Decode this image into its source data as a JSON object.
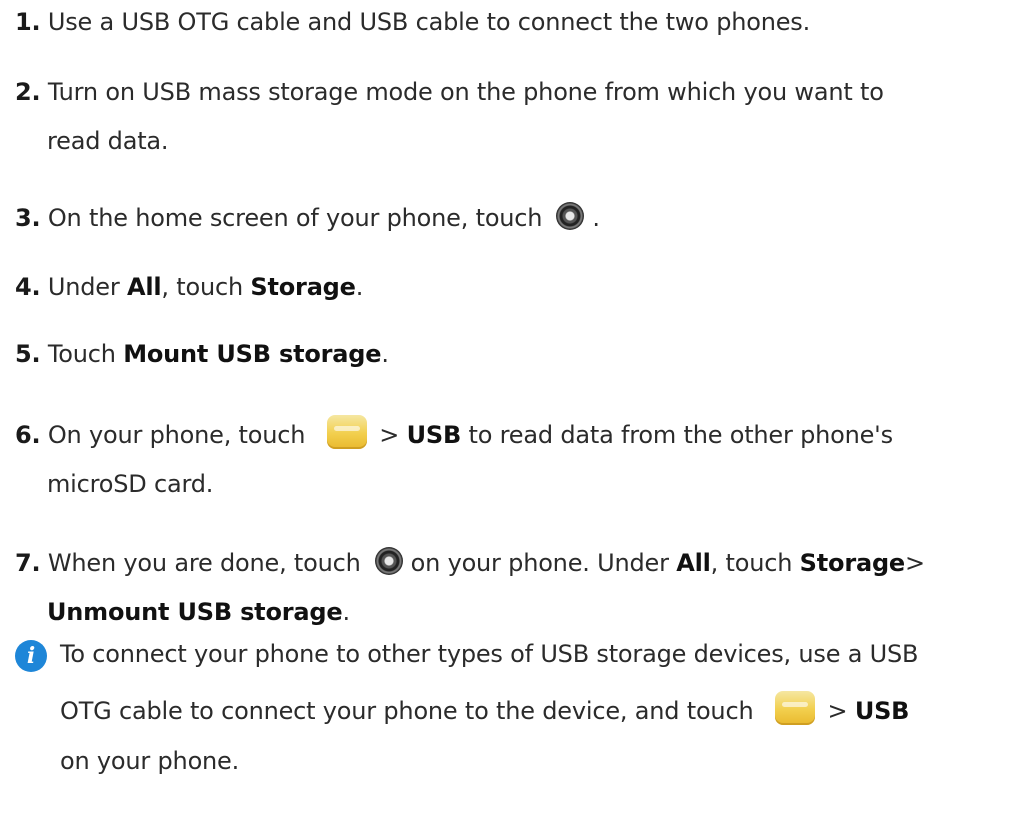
{
  "steps": [
    {
      "number": "1.",
      "text": "Use a USB OTG cable and USB cable to connect the two phones."
    },
    {
      "number": "2.",
      "line1": "Turn on USB mass storage mode on the phone from which you want to",
      "line2": "read data."
    },
    {
      "number": "3.",
      "before": "On the home screen of your phone, touch",
      "after": "."
    },
    {
      "number": "4.",
      "t1": "Under",
      "b1": "All",
      "t2": ", touch",
      "b2": "Storage",
      "t3": "."
    },
    {
      "number": "5.",
      "t1": "Touch",
      "b1": "Mount USB storage",
      "t2": "."
    },
    {
      "number": "6.",
      "before": "On your phone, touch",
      "gt": ">",
      "bold": "USB",
      "after": "to read data from the other phone's",
      "line2": "microSD card."
    },
    {
      "number": "7.",
      "before": "When you are done, touch",
      "after": "on your phone. Under",
      "b1": "All",
      "t2": ", touch",
      "b2": "Storage",
      "gt": ">",
      "line2_bold": "Unmount USB storage",
      "line2_end": "."
    }
  ],
  "note": {
    "icon": "info-icon",
    "line1": "To connect your phone to other types of USB storage devices, use a USB",
    "line2_before": "OTG cable to connect your phone to the device, and touch",
    "gt": ">",
    "bold": "USB",
    "line3": "on your phone."
  },
  "icons": {
    "settings": "gear-icon",
    "files": "files-icon"
  },
  "colors": {
    "text": "#2b2b2b",
    "info_blue": "#1e86d8",
    "files_yellow": "#f2cf4d"
  }
}
